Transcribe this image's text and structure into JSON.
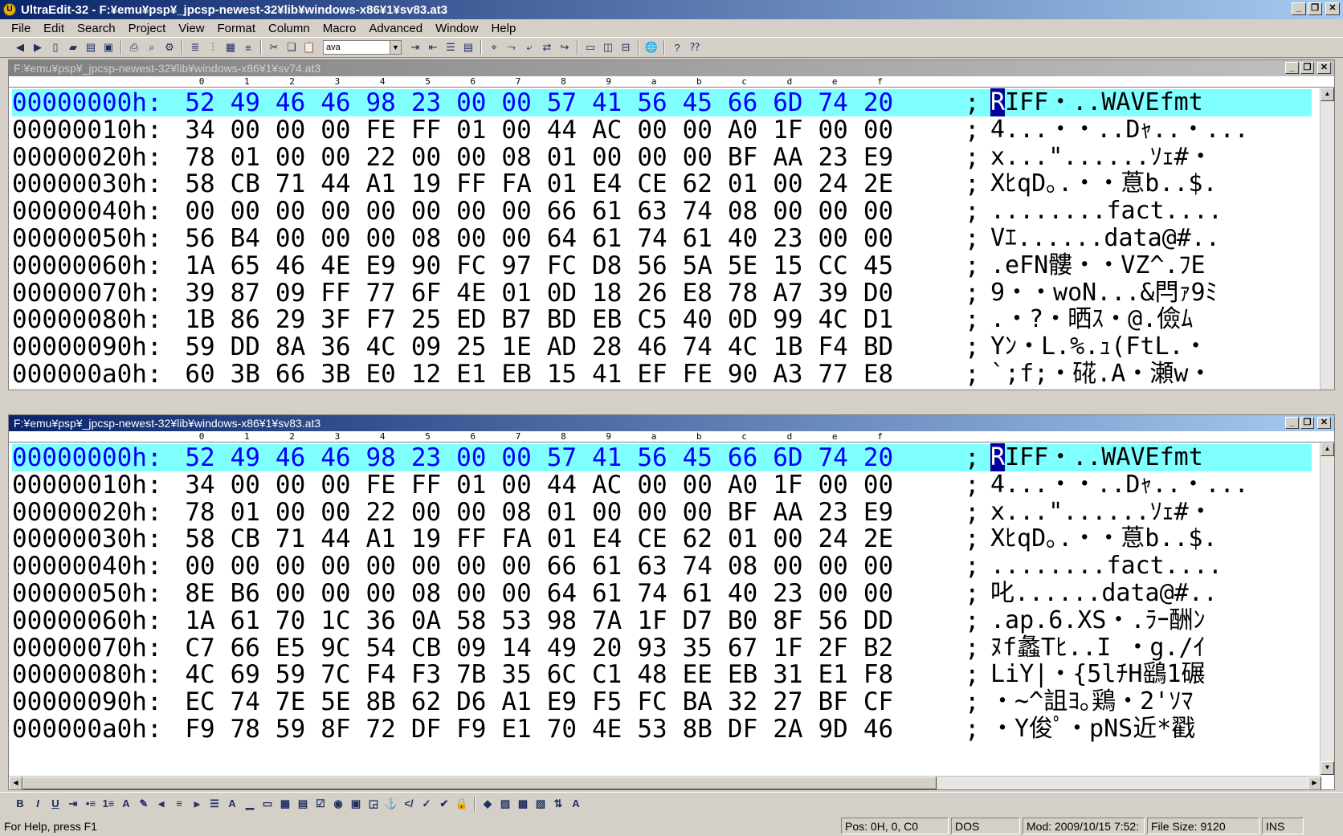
{
  "app": {
    "title": "UltraEdit-32 - F:¥emu¥psp¥_jpcsp-newest-32¥lib¥windows-x86¥1¥sv83.at3"
  },
  "menu": [
    "File",
    "Edit",
    "Search",
    "Project",
    "View",
    "Format",
    "Column",
    "Macro",
    "Advanced",
    "Window",
    "Help"
  ],
  "toolbar": {
    "syntax_select": "ava"
  },
  "ruler": [
    "0",
    "1",
    "2",
    "3",
    "4",
    "5",
    "6",
    "7",
    "8",
    "9",
    "a",
    "b",
    "c",
    "d",
    "e",
    "f"
  ],
  "windows": [
    {
      "title": "F:¥emu¥psp¥_jpcsp-newest-32¥lib¥windows-x86¥1¥sv74.at3",
      "active": false,
      "rows": [
        {
          "off": "00000000h:",
          "bytes": [
            "52",
            "49",
            "46",
            "46",
            "98",
            "23",
            "00",
            "00",
            "57",
            "41",
            "56",
            "45",
            "66",
            "6D",
            "74",
            "20"
          ],
          "ascii_caret": "R",
          "ascii": "IFF・..WAVEfmt "
        },
        {
          "off": "00000010h:",
          "bytes": [
            "34",
            "00",
            "00",
            "00",
            "FE",
            "FF",
            "01",
            "00",
            "44",
            "AC",
            "00",
            "00",
            "A0",
            "1F",
            "00",
            "00"
          ],
          "ascii": "4...・・..Dｬ..・..."
        },
        {
          "off": "00000020h:",
          "bytes": [
            "78",
            "01",
            "00",
            "00",
            "22",
            "00",
            "00",
            "08",
            "01",
            "00",
            "00",
            "00",
            "BF",
            "AA",
            "23",
            "E9"
          ],
          "ascii": "x...\"......ｿｪ#・"
        },
        {
          "off": "00000030h:",
          "bytes": [
            "58",
            "CB",
            "71",
            "44",
            "A1",
            "19",
            "FF",
            "FA",
            "01",
            "E4",
            "CE",
            "62",
            "01",
            "00",
            "24",
            "2E"
          ],
          "ascii": "XﾋqD｡.・・蒠b..$."
        },
        {
          "off": "00000040h:",
          "bytes": [
            "00",
            "00",
            "00",
            "00",
            "00",
            "00",
            "00",
            "00",
            "66",
            "61",
            "63",
            "74",
            "08",
            "00",
            "00",
            "00"
          ],
          "ascii": "........fact...."
        },
        {
          "off": "00000050h:",
          "bytes": [
            "56",
            "B4",
            "00",
            "00",
            "00",
            "08",
            "00",
            "00",
            "64",
            "61",
            "74",
            "61",
            "40",
            "23",
            "00",
            "00"
          ],
          "ascii": "Vｴ......data@#.."
        },
        {
          "off": "00000060h:",
          "bytes": [
            "1A",
            "65",
            "46",
            "4E",
            "E9",
            "90",
            "FC",
            "97",
            "FC",
            "D8",
            "56",
            "5A",
            "5E",
            "15",
            "CC",
            "45"
          ],
          "ascii": ".eFN髏・・VZ^.ﾌE"
        },
        {
          "off": "00000070h:",
          "bytes": [
            "39",
            "87",
            "09",
            "FF",
            "77",
            "6F",
            "4E",
            "01",
            "0D",
            "18",
            "26",
            "E8",
            "78",
            "A7",
            "39",
            "D0"
          ],
          "ascii": "9・・woN...&閂ｧ9ﾐ"
        },
        {
          "off": "00000080h:",
          "bytes": [
            "1B",
            "86",
            "29",
            "3F",
            "F7",
            "25",
            "ED",
            "B7",
            "BD",
            "EB",
            "C5",
            "40",
            "0D",
            "99",
            "4C",
            "D1"
          ],
          "ascii": ".・?・晒ｽ・@.儉ﾑ"
        },
        {
          "off": "00000090h:",
          "bytes": [
            "59",
            "DD",
            "8A",
            "36",
            "4C",
            "09",
            "25",
            "1E",
            "AD",
            "28",
            "46",
            "74",
            "4C",
            "1B",
            "F4",
            "BD"
          ],
          "ascii": "Yﾝ・L.%.ｭ(FtL.・"
        },
        {
          "off": "000000a0h:",
          "bytes": [
            "60",
            "3B",
            "66",
            "3B",
            "E0",
            "12",
            "E1",
            "EB",
            "15",
            "41",
            "EF",
            "FE",
            "90",
            "A3",
            "77",
            "E8"
          ],
          "ascii": "`;f;・硴.A・瀬w・"
        }
      ]
    },
    {
      "title": "F:¥emu¥psp¥_jpcsp-newest-32¥lib¥windows-x86¥1¥sv83.at3",
      "active": true,
      "rows": [
        {
          "off": "00000000h:",
          "bytes": [
            "52",
            "49",
            "46",
            "46",
            "98",
            "23",
            "00",
            "00",
            "57",
            "41",
            "56",
            "45",
            "66",
            "6D",
            "74",
            "20"
          ],
          "ascii_caret": "R",
          "ascii": "IFF・..WAVEfmt "
        },
        {
          "off": "00000010h:",
          "bytes": [
            "34",
            "00",
            "00",
            "00",
            "FE",
            "FF",
            "01",
            "00",
            "44",
            "AC",
            "00",
            "00",
            "A0",
            "1F",
            "00",
            "00"
          ],
          "ascii": "4...・・..Dｬ..・..."
        },
        {
          "off": "00000020h:",
          "bytes": [
            "78",
            "01",
            "00",
            "00",
            "22",
            "00",
            "00",
            "08",
            "01",
            "00",
            "00",
            "00",
            "BF",
            "AA",
            "23",
            "E9"
          ],
          "ascii": "x...\"......ｿｪ#・"
        },
        {
          "off": "00000030h:",
          "bytes": [
            "58",
            "CB",
            "71",
            "44",
            "A1",
            "19",
            "FF",
            "FA",
            "01",
            "E4",
            "CE",
            "62",
            "01",
            "00",
            "24",
            "2E"
          ],
          "ascii": "XﾋqD｡.・・蒠b..$."
        },
        {
          "off": "00000040h:",
          "bytes": [
            "00",
            "00",
            "00",
            "00",
            "00",
            "00",
            "00",
            "00",
            "66",
            "61",
            "63",
            "74",
            "08",
            "00",
            "00",
            "00"
          ],
          "ascii": "........fact...."
        },
        {
          "off": "00000050h:",
          "bytes": [
            "8E",
            "B6",
            "00",
            "00",
            "00",
            "08",
            "00",
            "00",
            "64",
            "61",
            "74",
            "61",
            "40",
            "23",
            "00",
            "00"
          ],
          "ascii": "叱......data@#.."
        },
        {
          "off": "00000060h:",
          "bytes": [
            "1A",
            "61",
            "70",
            "1C",
            "36",
            "0A",
            "58",
            "53",
            "98",
            "7A",
            "1F",
            "D7",
            "B0",
            "8F",
            "56",
            "DD"
          ],
          "ascii": ".ap.6.XS・.ﾗｰ酬ﾝ"
        },
        {
          "off": "00000070h:",
          "bytes": [
            "C7",
            "66",
            "E5",
            "9C",
            "54",
            "CB",
            "09",
            "14",
            "49",
            "20",
            "93",
            "35",
            "67",
            "1F",
            "2F",
            "B2"
          ],
          "ascii": "ﾇf蠡Tﾋ..I ・g./ｲ"
        },
        {
          "off": "00000080h:",
          "bytes": [
            "4C",
            "69",
            "59",
            "7C",
            "F4",
            "F3",
            "7B",
            "35",
            "6C",
            "C1",
            "48",
            "EE",
            "EB",
            "31",
            "E1",
            "F8"
          ],
          "ascii": "LiY|・{5lﾁH鷂1碾"
        },
        {
          "off": "00000090h:",
          "bytes": [
            "EC",
            "74",
            "7E",
            "5E",
            "8B",
            "62",
            "D6",
            "A1",
            "E9",
            "F5",
            "FC",
            "BA",
            "32",
            "27",
            "BF",
            "CF"
          ],
          "ascii": "・~^詛ﾖ｡鶏・2'ｿﾏ"
        },
        {
          "off": "000000a0h:",
          "bytes": [
            "F9",
            "78",
            "59",
            "8F",
            "72",
            "DF",
            "F9",
            "E1",
            "70",
            "4E",
            "53",
            "8B",
            "DF",
            "2A",
            "9D",
            "46"
          ],
          "ascii": "・Y俊ﾟ・pNS近*戳"
        }
      ]
    }
  ],
  "status": {
    "help": "For Help, press F1",
    "pos": "Pos: 0H, 0, C0",
    "format": "DOS",
    "modified": "Mod: 2009/10/15 7:52:",
    "filesize": "File Size: 9120",
    "mode": "INS"
  },
  "colors": {
    "cursor_row": "#80ffff",
    "active_title": "#0a246a",
    "offset_active": "#0000ff"
  }
}
